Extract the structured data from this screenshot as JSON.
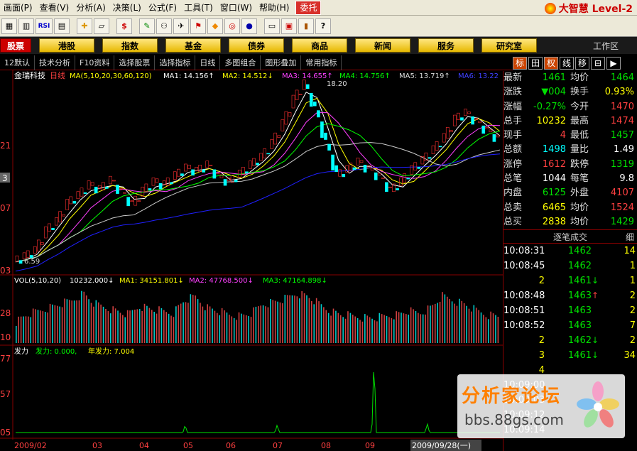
{
  "menu": [
    "画面(P)",
    "查看(V)",
    "分析(A)",
    "决策(L)",
    "公式(F)",
    "工具(T)",
    "窗口(W)",
    "帮助(H)",
    "委托"
  ],
  "brand": "大智慧 Level-2",
  "toolbar_icons": [
    "grid-icon",
    "kline-icon",
    "rsi-icon",
    "tile-icon",
    "crosshair-icon",
    "ruler-icon",
    "dollar-icon",
    "pen-icon",
    "binoculars-icon",
    "satellite-icon",
    "flag-icon",
    "diamond-icon",
    "ring-icon",
    "circle-icon",
    "doc-icon",
    "window-icon",
    "books-icon",
    "help-cursor-icon"
  ],
  "toolbar_rsi": "RSI",
  "toolbar_dollar": "$",
  "nav": [
    "股票",
    "港股",
    "指数",
    "基金",
    "债券",
    "商品",
    "新闻",
    "服务",
    "研究室"
  ],
  "workzone": "工作区",
  "subtoolbar": [
    "12默认",
    "技术分析",
    "F10资料",
    "选择股票",
    "选择指标",
    "日线",
    "多图组合",
    "图形叠加",
    "常用指标"
  ],
  "right_tabs": [
    "标",
    "田",
    "权",
    "线",
    "移",
    "⊟",
    "▶"
  ],
  "chart_labels": {
    "stock": "金瑞科技",
    "period": "日线",
    "ma_params": "MA(5,10,20,30,60,120)",
    "ma1": "MA1: 14.156↑",
    "ma2": "MA2: 14.512↓",
    "ma3": "MA3: 14.655↑",
    "ma4": "MA4: 14.756↑",
    "ma5": "MA5: 13.719↑",
    "ma6": "MA6: 13.22",
    "high_mark": "18.20",
    "low_mark": "6.59",
    "vol_params": "VOL(5,10,20)",
    "vol": "10232.000↓",
    "vol_ma1": "MA1: 34151.801↓",
    "vol_ma2": "MA2: 47768.500↓",
    "vol_ma3": "MA3: 47164.898↓",
    "fa_title": "发力",
    "fa_value": "发力: 0.000,",
    "fa_year": "年发力: 7.004",
    "y_price": [
      "21",
      "3",
      "07",
      "03"
    ],
    "y_vol": [
      "28",
      "10"
    ],
    "y_fa": [
      "77",
      "57",
      "05"
    ],
    "x_dates": [
      "2009/02",
      "03",
      "04",
      "05",
      "06",
      "07",
      "08",
      "09",
      "2009/09/28(一)"
    ]
  },
  "quote_rows": [
    {
      "l1": "最新",
      "v1": "1461",
      "c1": "green",
      "l2": "均价",
      "v2": "1464",
      "c2": "green"
    },
    {
      "l1": "涨跌",
      "v1": "▼004",
      "c1": "green",
      "l2": "换手",
      "v2": "0.93%",
      "c2": "yellow"
    },
    {
      "l1": "涨幅",
      "v1": "-0.27%",
      "c1": "green",
      "l2": "今开",
      "v2": "1470",
      "c2": "red"
    },
    {
      "l1": "总手",
      "v1": "10232",
      "c1": "yellow",
      "l2": "最高",
      "v2": "1474",
      "c2": "red"
    },
    {
      "l1": "现手",
      "v1": "4",
      "c1": "red",
      "l2": "最低",
      "v2": "1457",
      "c2": "green"
    },
    {
      "l1": "总额",
      "v1": "1498",
      "c1": "cyan",
      "l2": "量比",
      "v2": "1.49",
      "c2": "white"
    },
    {
      "l1": "涨停",
      "v1": "1612",
      "c1": "red",
      "l2": "跌停",
      "v2": "1319",
      "c2": "green"
    },
    {
      "l1": "总笔",
      "v1": "1044",
      "c1": "white",
      "l2": "每笔",
      "v2": "9.8",
      "c2": "white"
    },
    {
      "l1": "内盘",
      "v1": "6125",
      "c1": "green",
      "l2": "外盘",
      "v2": "4107",
      "c2": "red"
    },
    {
      "l1": "总卖",
      "v1": "6465",
      "c1": "yellow",
      "l2": "均价",
      "v2": "1524",
      "c2": "red"
    },
    {
      "l1": "总买",
      "v1": "2838",
      "c1": "yellow",
      "l2": "均价",
      "v2": "1429",
      "c2": "green"
    }
  ],
  "tick_title": "逐笔成交",
  "tick_detail": "细",
  "ticks": [
    {
      "t": "10:08:31",
      "p": "1462",
      "c": "green",
      "a": "",
      "v": "14"
    },
    {
      "t": "10:08:45",
      "p": "1462",
      "c": "green",
      "a": "",
      "v": "1"
    },
    {
      "t": "2",
      "p": "1461",
      "c": "green",
      "a": "↓",
      "v": "1"
    },
    {
      "t": "10:08:48",
      "p": "1463",
      "c": "green",
      "a": "↑",
      "v": "2"
    },
    {
      "t": "10:08:51",
      "p": "1463",
      "c": "green",
      "a": "",
      "v": "2"
    },
    {
      "t": "10:08:52",
      "p": "1463",
      "c": "green",
      "a": "",
      "v": "7"
    },
    {
      "t": "2",
      "p": "1462",
      "c": "green",
      "a": "↓",
      "v": "2"
    },
    {
      "t": "3",
      "p": "1461",
      "c": "green",
      "a": "↓",
      "v": "34"
    },
    {
      "t": "4",
      "p": "",
      "c": "green",
      "a": "",
      "v": ""
    },
    {
      "t": "10:09:00",
      "p": "",
      "c": "green",
      "a": "",
      "v": ""
    },
    {
      "t": "10:09:03",
      "p": "",
      "c": "green",
      "a": "",
      "v": ""
    },
    {
      "t": "10:09:12",
      "p": "",
      "c": "green",
      "a": "",
      "v": ""
    },
    {
      "t": "10:09:14",
      "p": "",
      "c": "green",
      "a": "",
      "v": ""
    }
  ],
  "watermark": {
    "title": "分析家论坛",
    "url": "bbs.88gs.com"
  },
  "chart_data": {
    "type": "line",
    "price_axis_labels": [
      "21",
      "3",
      "07",
      "03"
    ],
    "price_range": [
      6.59,
      18.2
    ],
    "price_path": [
      6.6,
      6.9,
      7.3,
      8.6,
      9.2,
      10.4,
      10.9,
      11.6,
      11.3,
      11.9,
      11.1,
      10.3,
      11.2,
      11.8,
      11.6,
      12.2,
      12.7,
      12.5,
      12.9,
      12.1,
      11.8,
      12.3,
      12.9,
      13.4,
      14.3,
      15.6,
      17.2,
      18.2,
      16.5,
      14.3,
      12.2,
      12.6,
      13.1,
      12.6,
      12.1,
      11.2,
      11.8,
      12.6,
      13.2,
      13.9,
      14.7,
      15.9,
      16.3,
      15.7,
      15.1,
      14.6
    ],
    "volume_path": [
      30,
      40,
      45,
      50,
      55,
      60,
      70,
      55,
      50,
      45,
      40,
      52,
      48,
      45,
      42,
      60,
      65,
      50,
      45,
      40,
      38,
      42,
      55,
      58,
      62,
      70,
      66,
      55,
      45,
      40,
      38,
      36,
      35,
      38,
      40,
      45,
      42,
      50,
      66,
      60,
      55,
      46,
      40,
      38
    ],
    "fa_spike_positions": [
      0.35,
      0.54,
      0.74,
      0.85
    ],
    "fa_spike_heights": [
      0.1,
      0.1,
      1.0,
      0.12
    ]
  }
}
